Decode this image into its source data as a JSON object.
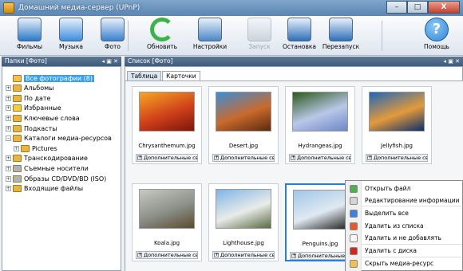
{
  "window": {
    "title": "Домашний медиа-сервер (UPnP)"
  },
  "titlebar_buttons": [
    "–",
    "□",
    "X"
  ],
  "toolbar": [
    {
      "label": "Фильмы",
      "icon": "film-icon",
      "enabled": true
    },
    {
      "label": "Музыка",
      "icon": "music-icon",
      "enabled": true
    },
    {
      "label": "Фото",
      "icon": "photo-icon",
      "enabled": true
    },
    {
      "label": "Обновить",
      "icon": "refresh-icon",
      "enabled": true
    },
    {
      "label": "Настройки",
      "icon": "settings-icon",
      "enabled": true
    },
    {
      "label": "Запуск",
      "icon": "start-icon",
      "enabled": false
    },
    {
      "label": "Остановка",
      "icon": "stop-icon",
      "enabled": true
    },
    {
      "label": "Перезапуск",
      "icon": "restart-icon",
      "enabled": true
    },
    {
      "label": "Помощь",
      "icon": "help-icon",
      "enabled": true
    }
  ],
  "left_panel": {
    "title": "Папки [Фото]",
    "pin": "◂ ▣ ✕",
    "tree": [
      {
        "label": "Все фотографии (8)",
        "selected": true,
        "expander": "",
        "color": "#f2c14e"
      },
      {
        "label": "Альбомы",
        "expander": "+",
        "color": "#e8b640"
      },
      {
        "label": "По дате",
        "expander": "+",
        "color": "#e8b640"
      },
      {
        "label": "Избранные",
        "expander": "+",
        "color": "#f0d040"
      },
      {
        "label": "Ключевые слова",
        "expander": "+",
        "color": "#e8b640"
      },
      {
        "label": "Подкасты",
        "expander": "+",
        "color": "#e8b640"
      },
      {
        "label": "Каталоги медиа-ресурсов",
        "expander": "–",
        "color": "#e8b640"
      },
      {
        "label": "Pictures",
        "expander": "+",
        "color": "#e8b640",
        "indent": 1
      },
      {
        "label": "Транскодирование",
        "expander": "+",
        "color": "#e8b640"
      },
      {
        "label": "Съемные носители",
        "expander": "+",
        "color": "#aab4c0"
      },
      {
        "label": "Образы CD/DVD/BD (ISO)",
        "expander": "+",
        "color": "#aab4c0"
      },
      {
        "label": "Входящие файлы",
        "expander": "+",
        "color": "#e8b640"
      }
    ]
  },
  "main_panel": {
    "title": "Список [Фото]",
    "pin": "◂ ▣ ✕",
    "tabs": [
      {
        "label": "Таблица"
      },
      {
        "label": "Карточки",
        "active": true
      }
    ],
    "more_label": "Дополнительные свойства",
    "items": [
      {
        "name": "Chrysanthemum.jpg",
        "colors": [
          "#f5a623",
          "#d0401b",
          "#7a1608"
        ]
      },
      {
        "name": "Desert.jpg",
        "colors": [
          "#3b8fd8",
          "#c96a2c",
          "#5b2a0e"
        ]
      },
      {
        "name": "Hydrangeas.jpg",
        "colors": [
          "#2d5a1b",
          "#b9c7e8",
          "#6d87c6"
        ]
      },
      {
        "name": "Jellyfish.jpg",
        "colors": [
          "#1f66b8",
          "#e49a3a",
          "#0b2f6b"
        ]
      },
      {
        "name": "Koala.jpg",
        "colors": [
          "#c7c9c2",
          "#8a8f88",
          "#5d4a2d"
        ]
      },
      {
        "name": "Lighthouse.jpg",
        "colors": [
          "#7fb4e6",
          "#e9ece9",
          "#5a6a42"
        ]
      },
      {
        "name": "Penguins.jpg",
        "colors": [
          "#9fc6e8",
          "#e0e9f2",
          "#222222"
        ],
        "selected": true
      }
    ]
  },
  "context_menu": [
    {
      "label": "Открыть файл",
      "icon": "open-file-icon",
      "color": "#4caf50"
    },
    {
      "label": "Редактирование информации",
      "icon": "edit-info-icon",
      "color": "#d4d4d4"
    },
    {
      "label": "Выделить все",
      "icon": "select-all-icon",
      "color": "#3f7fd8"
    },
    {
      "label": "Удалить из списка",
      "icon": "remove-list-icon",
      "color": "#e35b2c"
    },
    {
      "label": "Удалить и не добавлять",
      "icon": "remove-noadd-icon",
      "color": "#f7f7f7"
    },
    {
      "label": "Удалить с диска",
      "icon": "delete-disk-icon",
      "color": "#d8261b"
    },
    {
      "label": "Скрыть медиа-ресурс",
      "icon": "hide-resource-icon",
      "color": "#f2c14e"
    }
  ]
}
